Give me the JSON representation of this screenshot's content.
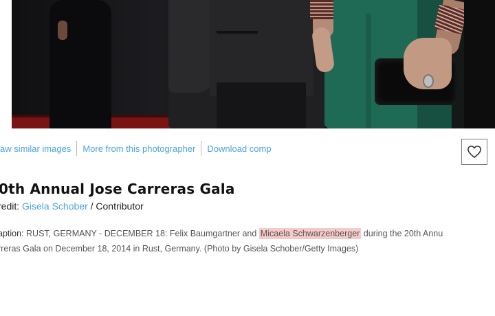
{
  "actions": {
    "view_similar": "aw similar images",
    "more_from_photographer": "More from this photographer",
    "download_comp": "Download comp"
  },
  "icons": {
    "favorite": "heart-outline-icon"
  },
  "image": {
    "title": "0th Annual Jose Carreras Gala",
    "credit_label": "redit:",
    "photographer": "Gisela Schober",
    "credit_suffix": "/ Contributor",
    "caption_label": "aption:",
    "caption_part1": "RUST, GERMANY - DECEMBER 18: Felix Baumgartner and",
    "caption_highlight": "Micaela Schwarzenberger",
    "caption_part2": "during the 20th Annu",
    "caption_line2": "rreras Gala on December 18, 2014 in Rust, Germany. (Photo by Gisela Schober/Getty Images)"
  },
  "colors": {
    "link": "#4aa3df",
    "highlight": "#f7caca",
    "text_dark": "#111111",
    "text_muted": "#555555"
  }
}
